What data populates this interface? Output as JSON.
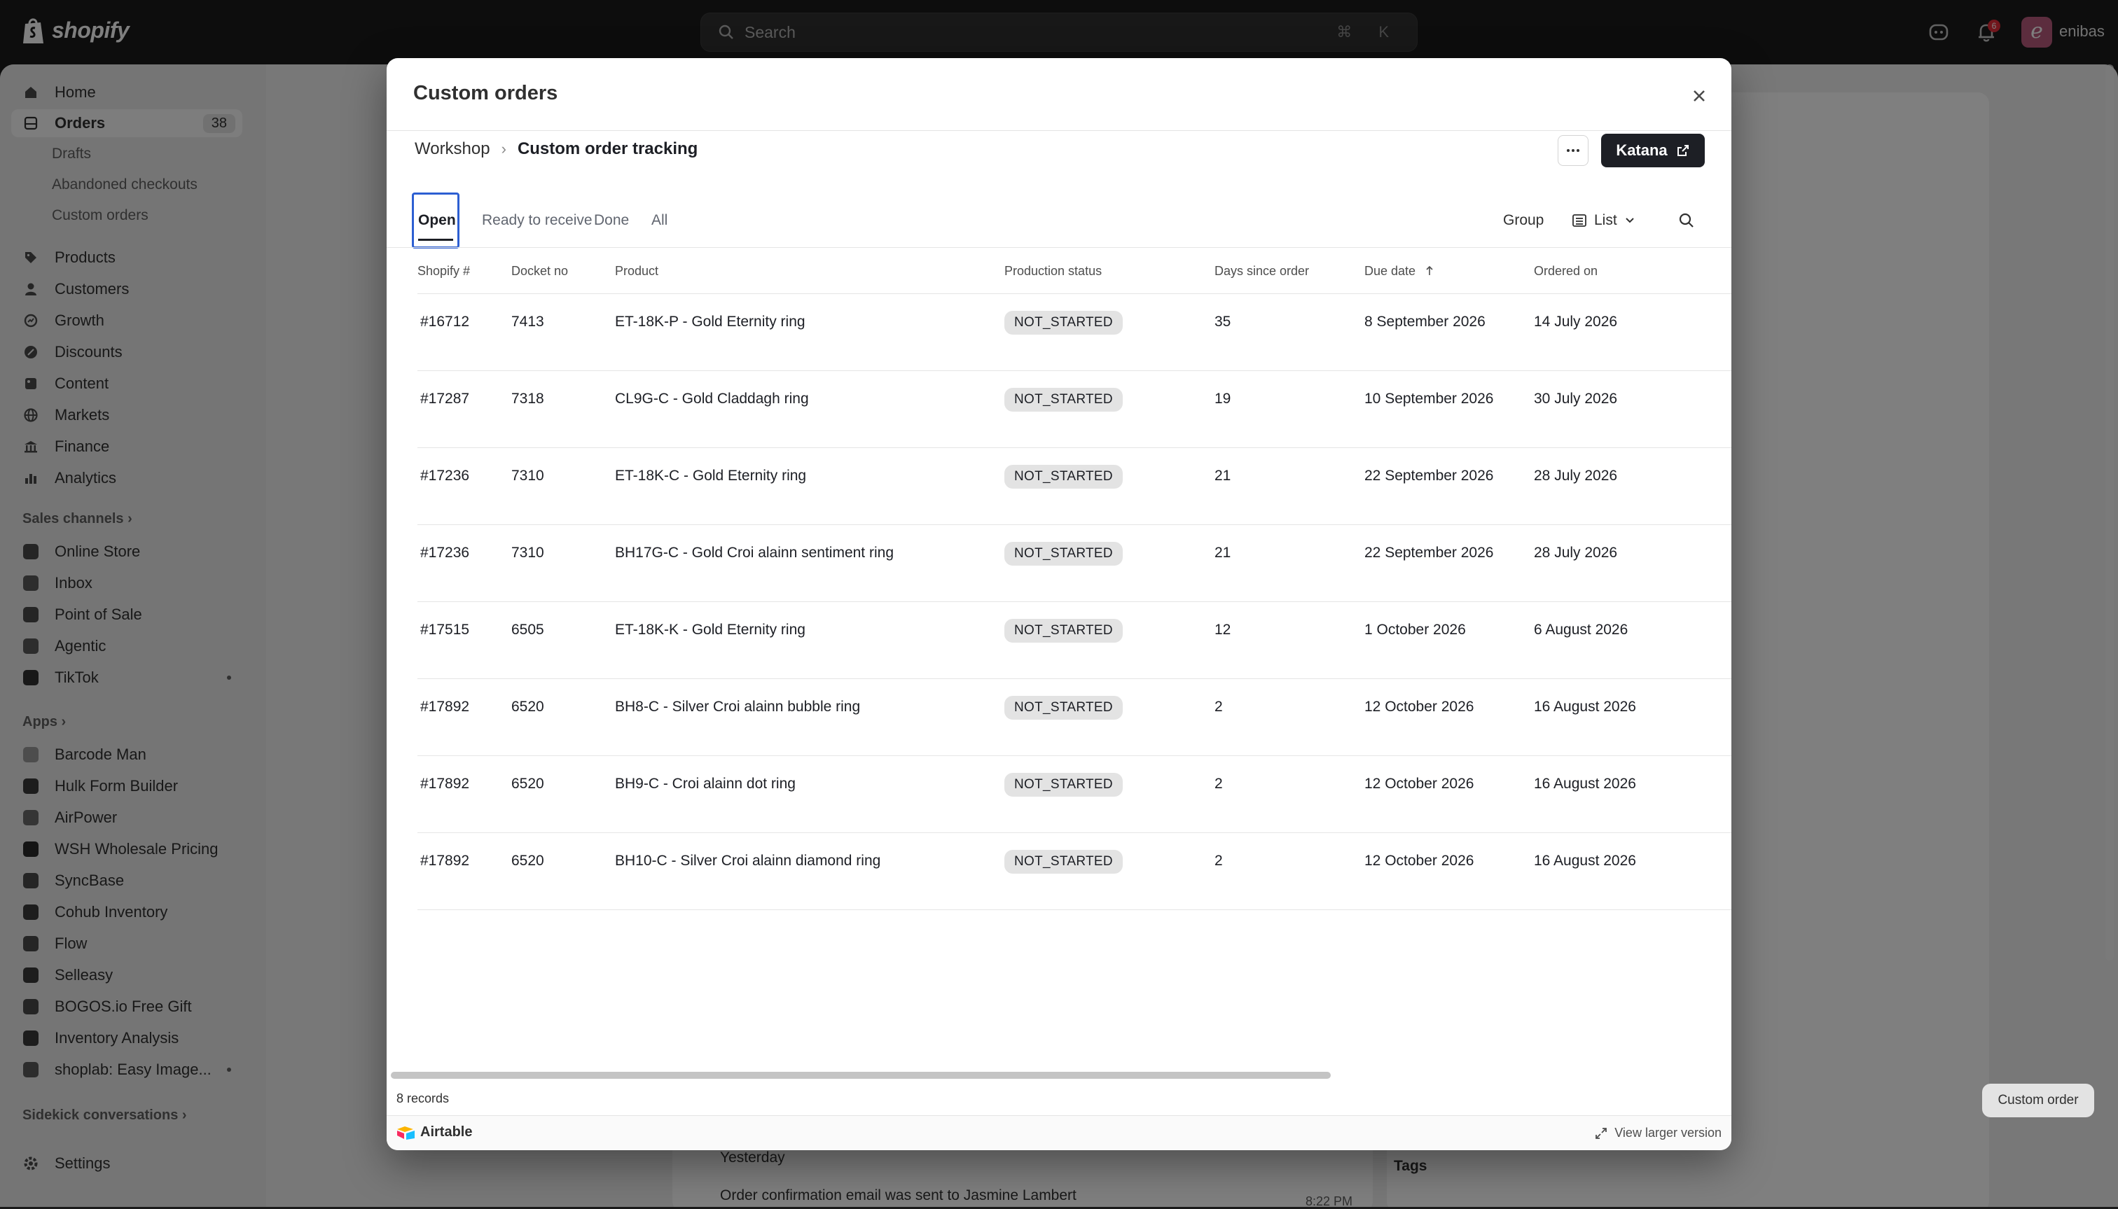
{
  "topbar": {
    "brand": "shopify",
    "search_placeholder": "Search",
    "search_shortcut": "⌘ K",
    "notification_count": "6",
    "avatar_letter": "e",
    "store_name": "enibas"
  },
  "sidebar": {
    "items": [
      {
        "label": "Home",
        "icon": "home-icon"
      },
      {
        "label": "Orders",
        "icon": "orders-icon",
        "count": "38"
      },
      {
        "label": "Drafts"
      },
      {
        "label": "Abandoned checkouts"
      },
      {
        "label": "Custom orders"
      },
      {
        "label": "Products",
        "icon": "tag-icon"
      },
      {
        "label": "Customers",
        "icon": "person-icon"
      },
      {
        "label": "Growth",
        "icon": "growth-icon"
      },
      {
        "label": "Discounts",
        "icon": "discount-icon"
      },
      {
        "label": "Content",
        "icon": "content-icon"
      },
      {
        "label": "Markets",
        "icon": "globe-icon"
      },
      {
        "label": "Finance",
        "icon": "bank-icon"
      },
      {
        "label": "Analytics",
        "icon": "chart-icon"
      }
    ],
    "sales_channels_title": "Sales channels",
    "sales_channels": [
      "Online Store",
      "Inbox",
      "Point of Sale",
      "Agentic",
      "TikTok"
    ],
    "apps_title": "Apps",
    "apps": [
      "Barcode Man",
      "Hulk Form Builder",
      "AirPower",
      "WSH Wholesale Pricing",
      "SyncBase",
      "Cohub Inventory",
      "Flow",
      "Selleasy",
      "BOGOS.io Free Gift",
      "Inventory Analysis",
      "shoplab: Easy Image..."
    ],
    "sidekick_title": "Sidekick conversations",
    "settings_label": "Settings"
  },
  "background": {
    "timeline_day": "Yesterday",
    "timeline_event": "Order confirmation email was sent to Jasmine Lambert",
    "timeline_time": "8:22 PM",
    "tags_label": "Tags",
    "custom_order_button": "Custom order"
  },
  "modal": {
    "title": "Custom orders",
    "breadcrumb_base": "Workshop",
    "breadcrumb_current": "Custom order tracking",
    "katana_label": "Katana",
    "tabs": [
      "Open",
      "Ready to receive",
      "Done",
      "All"
    ],
    "group_label": "Group",
    "view_label": "List",
    "columns": [
      "Shopify #",
      "Docket no",
      "Product",
      "Production status",
      "Days since order",
      "Due date",
      "Ordered on"
    ],
    "rows": [
      {
        "shopify": "#16712",
        "docket": "7413",
        "product": "ET-18K-P - Gold Eternity ring",
        "status": "NOT_STARTED",
        "days": "35",
        "due": "8 September 2026",
        "ordered": "14 July 2026"
      },
      {
        "shopify": "#17287",
        "docket": "7318",
        "product": "CL9G-C - Gold Claddagh ring",
        "status": "NOT_STARTED",
        "days": "19",
        "due": "10 September 2026",
        "ordered": "30 July 2026"
      },
      {
        "shopify": "#17236",
        "docket": "7310",
        "product": "ET-18K-C - Gold Eternity ring",
        "status": "NOT_STARTED",
        "days": "21",
        "due": "22 September 2026",
        "ordered": "28 July 2026"
      },
      {
        "shopify": "#17236",
        "docket": "7310",
        "product": "BH17G-C - Gold Croi alainn sentiment ring",
        "status": "NOT_STARTED",
        "days": "21",
        "due": "22 September 2026",
        "ordered": "28 July 2026"
      },
      {
        "shopify": "#17515",
        "docket": "6505",
        "product": "ET-18K-K - Gold Eternity ring",
        "status": "NOT_STARTED",
        "days": "12",
        "due": "1 October 2026",
        "ordered": "6 August 2026"
      },
      {
        "shopify": "#17892",
        "docket": "6520",
        "product": "BH8-C - Silver Croi alainn bubble ring",
        "status": "NOT_STARTED",
        "days": "2",
        "due": "12 October 2026",
        "ordered": "16 August 2026"
      },
      {
        "shopify": "#17892",
        "docket": "6520",
        "product": "BH9-C - Croi alainn dot ring",
        "status": "NOT_STARTED",
        "days": "2",
        "due": "12 October 2026",
        "ordered": "16 August 2026"
      },
      {
        "shopify": "#17892",
        "docket": "6520",
        "product": "BH10-C - Silver Croi alainn diamond ring",
        "status": "NOT_STARTED",
        "days": "2",
        "due": "12 October 2026",
        "ordered": "16 August 2026"
      }
    ],
    "records_text": "8 records",
    "airtable_label": "Airtable",
    "larger_version_label": "View larger version"
  },
  "colors": {
    "topbar": "#1a1a1a",
    "accent_focus": "#2d5fd2",
    "status_pill": "#e3e3e3",
    "katana_button": "#1d1f25"
  }
}
